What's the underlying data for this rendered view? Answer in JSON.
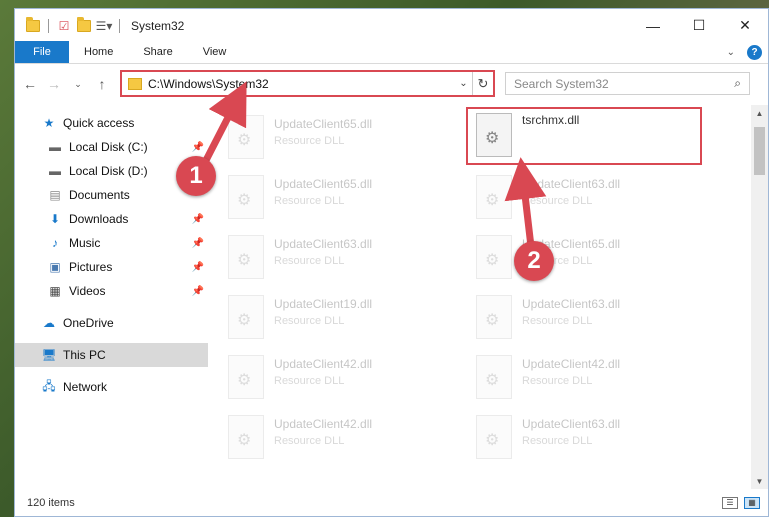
{
  "window": {
    "title": "System32",
    "controls": {
      "minimize": "—",
      "maximize": "☐",
      "close": "✕"
    }
  },
  "ribbon": {
    "tabs": [
      "File",
      "Home",
      "Share",
      "View"
    ],
    "help": "?"
  },
  "address": {
    "path": "C:\\Windows\\System32",
    "search_placeholder": "Search System32"
  },
  "sidebar": {
    "quick_access": "Quick access",
    "items": [
      {
        "label": "Local Disk (C:)",
        "icon": "drive-icon",
        "pinned": true
      },
      {
        "label": "Local Disk (D:)",
        "icon": "drive-icon",
        "pinned": false
      },
      {
        "label": "Documents",
        "icon": "documents-icon",
        "pinned": false
      },
      {
        "label": "Downloads",
        "icon": "downloads-icon",
        "pinned": true
      },
      {
        "label": "Music",
        "icon": "music-icon",
        "pinned": true
      },
      {
        "label": "Pictures",
        "icon": "pictures-icon",
        "pinned": true
      },
      {
        "label": "Videos",
        "icon": "videos-icon",
        "pinned": true
      }
    ],
    "onedrive": "OneDrive",
    "this_pc": "This PC",
    "network": "Network"
  },
  "files": {
    "col1": [
      {
        "name": "UpdateClient65.dll",
        "type": "Resource DLL"
      },
      {
        "name": "UpdateClient65.dll",
        "type": "Resource DLL"
      },
      {
        "name": "UpdateClient63.dll",
        "type": "Resource DLL"
      },
      {
        "name": "UpdateClient19.dll",
        "type": "Resource DLL"
      },
      {
        "name": "UpdateClient42.dll",
        "type": "Resource DLL"
      },
      {
        "name": "UpdateClient42.dll",
        "type": "Resource DLL"
      }
    ],
    "col2": [
      {
        "name": "tsrchmx.dll",
        "type": ""
      },
      {
        "name": "UpdateClient63.dll",
        "type": "Resource DLL"
      },
      {
        "name": "UpdateClient65.dll",
        "type": "Resource DLL"
      },
      {
        "name": "UpdateClient63.dll",
        "type": "Resource DLL"
      },
      {
        "name": "UpdateClient42.dll",
        "type": "Resource DLL"
      },
      {
        "name": "UpdateClient63.dll",
        "type": "Resource DLL"
      }
    ]
  },
  "status": {
    "item_count": "120 items"
  },
  "callouts": {
    "one": "1",
    "two": "2"
  },
  "colors": {
    "accent": "#1979ca",
    "highlight": "#d94852"
  }
}
